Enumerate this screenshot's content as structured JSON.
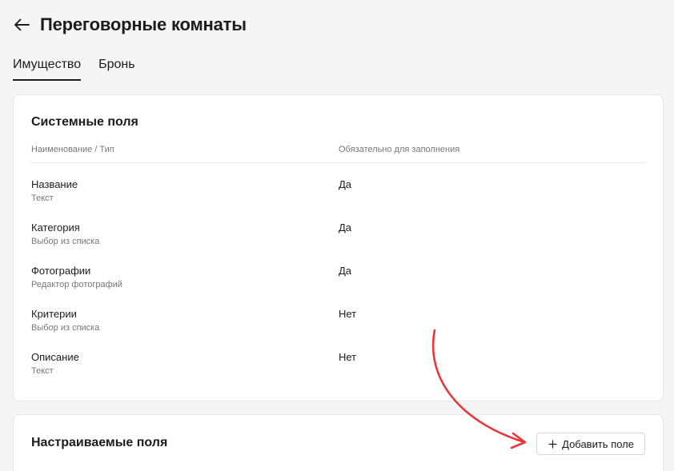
{
  "header": {
    "title": "Переговорные комнаты",
    "back_icon": "arrow-left-icon"
  },
  "tabs": [
    {
      "label": "Имущество",
      "active": true
    },
    {
      "label": "Бронь",
      "active": false
    }
  ],
  "system_fields": {
    "title": "Системные поля",
    "columns": [
      "Наименование / Тип",
      "Обязательно для заполнения"
    ],
    "rows": [
      {
        "name": "Название",
        "type": "Текст",
        "required": "Да"
      },
      {
        "name": "Категория",
        "type": "Выбор из списка",
        "required": "Да"
      },
      {
        "name": "Фотографии",
        "type": "Редактор фотографий",
        "required": "Да"
      },
      {
        "name": "Критерии",
        "type": "Выбор из списка",
        "required": "Нет"
      },
      {
        "name": "Описание",
        "type": "Текст",
        "required": "Нет"
      }
    ]
  },
  "custom_fields": {
    "title": "Настраиваемые поля",
    "add_button_label": "Добавить поле",
    "add_icon": "plus-icon"
  },
  "colors": {
    "annotation_arrow": "#e5393b"
  }
}
